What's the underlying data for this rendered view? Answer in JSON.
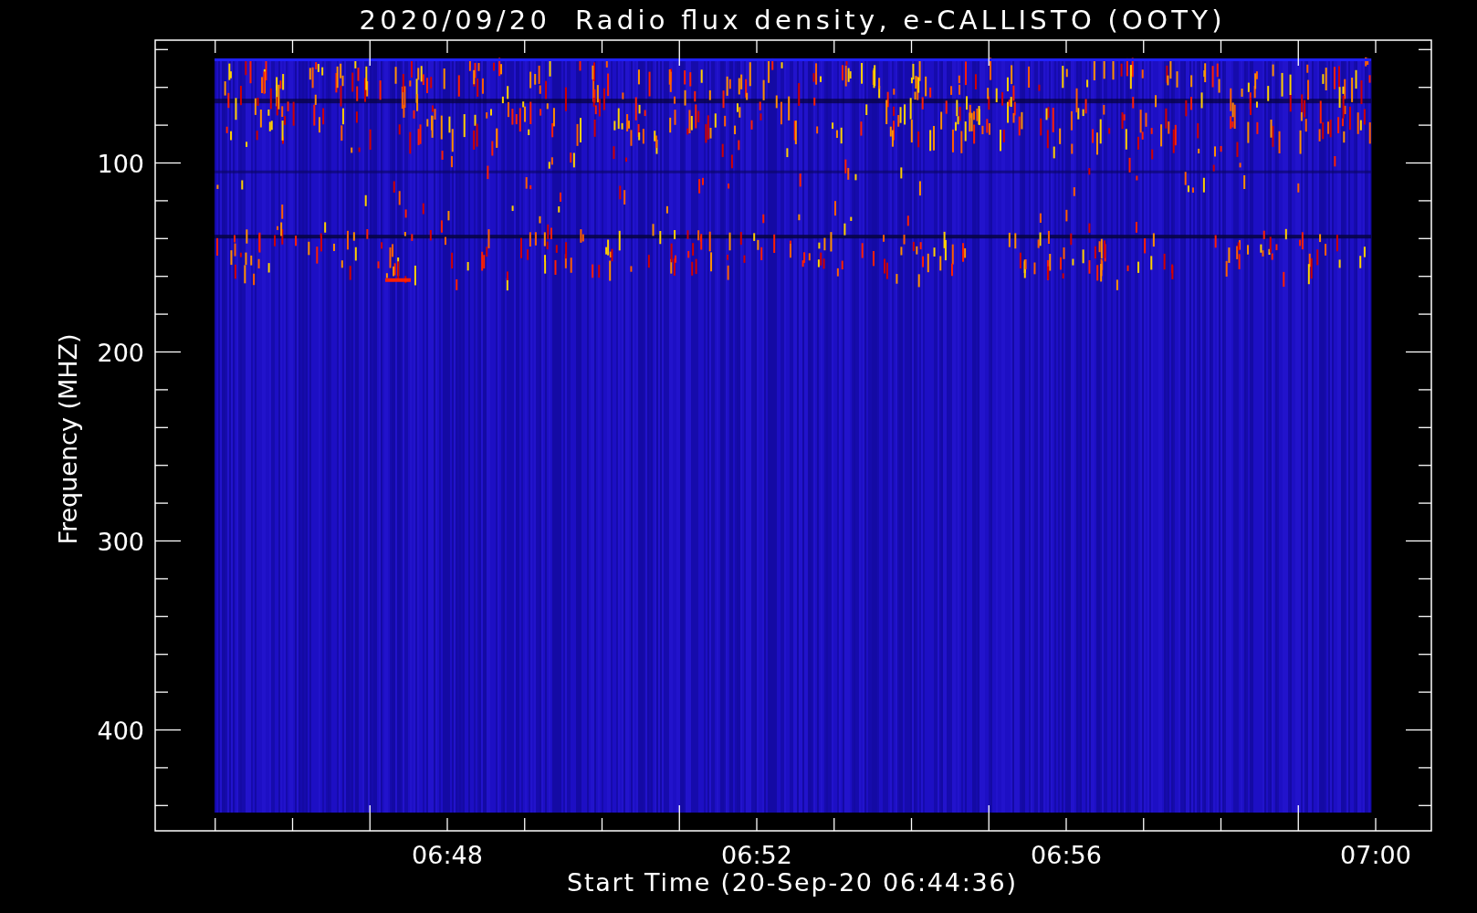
{
  "title": "2020/09/20  Radio flux density, e-CALLISTO (OOTY)",
  "y_axis": {
    "label": "Frequency (MHZ)",
    "ticks": [
      "100",
      "200",
      "300",
      "400"
    ]
  },
  "x_axis": {
    "label": "Start Time (20-Sep-20 06:44:36)",
    "ticks": [
      "06:48",
      "06:52",
      "06:56",
      "07:00"
    ]
  }
}
